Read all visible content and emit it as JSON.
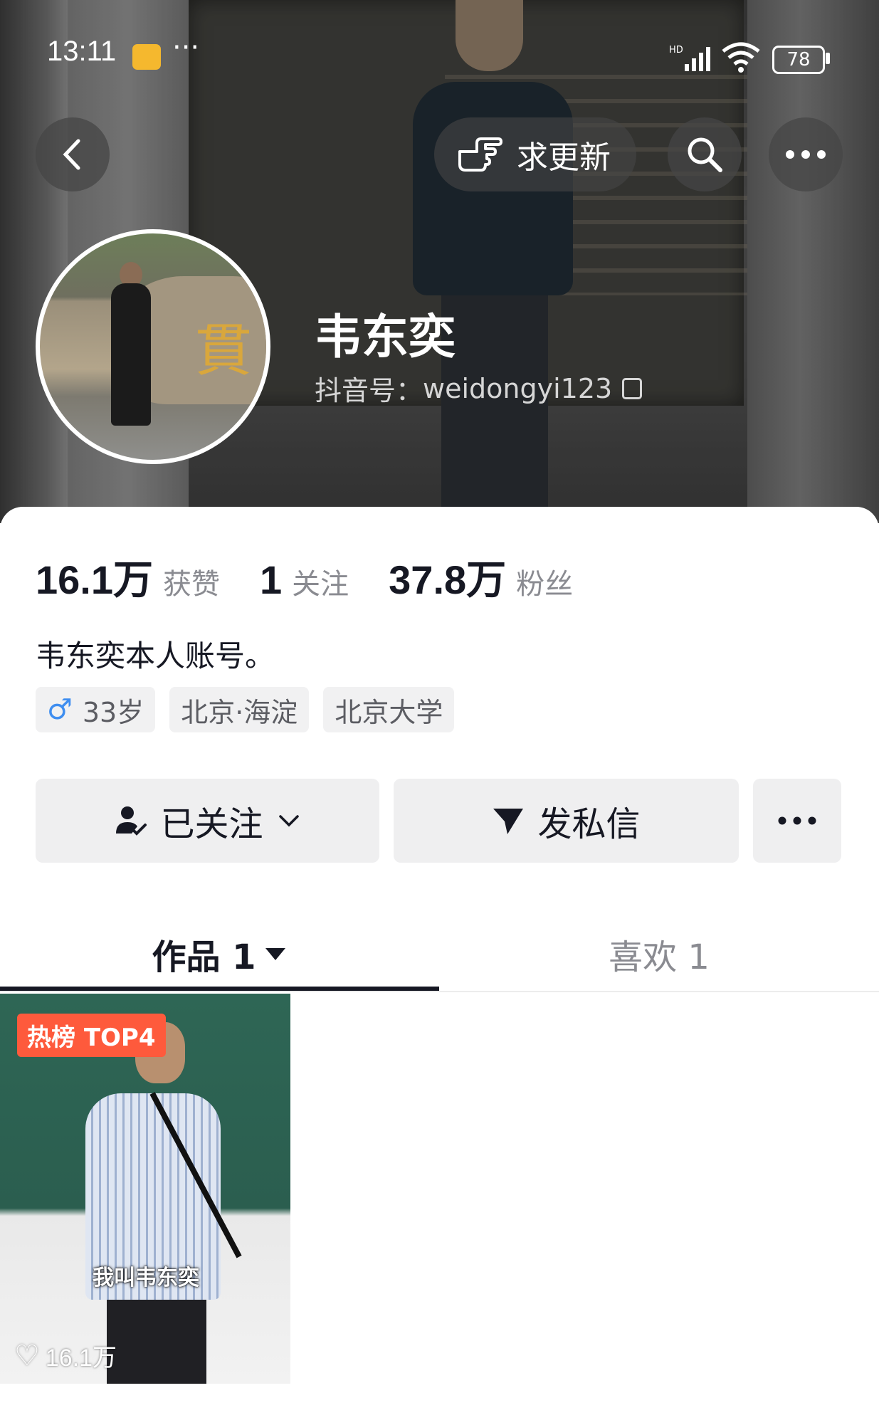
{
  "status_bar": {
    "time": "13:11",
    "battery": "78",
    "signal_label": "HD"
  },
  "header": {
    "request_update_label": "求更新",
    "name": "韦东奕",
    "id_label": "抖音号：",
    "id_value": "weidongyi123"
  },
  "stats": [
    {
      "value": "16.1万",
      "label": "获赞"
    },
    {
      "value": "1",
      "label": "关注"
    },
    {
      "value": "37.8万",
      "label": "粉丝"
    }
  ],
  "bio": "韦东奕本人账号。",
  "tags": {
    "age": "33岁",
    "location": "北京·海淀",
    "school": "北京大学"
  },
  "actions": {
    "follow_label": "已关注",
    "message_label": "发私信"
  },
  "tabs": {
    "works": "作品 1",
    "likes": "喜欢 1"
  },
  "video": {
    "badge": "热榜 TOP4",
    "caption": "我叫韦东奕",
    "likes": "16.1万"
  },
  "colors": {
    "accent_badge": "#fe5a3c",
    "gender_icon": "#3f8ef0",
    "text_primary": "#161823",
    "text_secondary": "#8a8b91"
  }
}
